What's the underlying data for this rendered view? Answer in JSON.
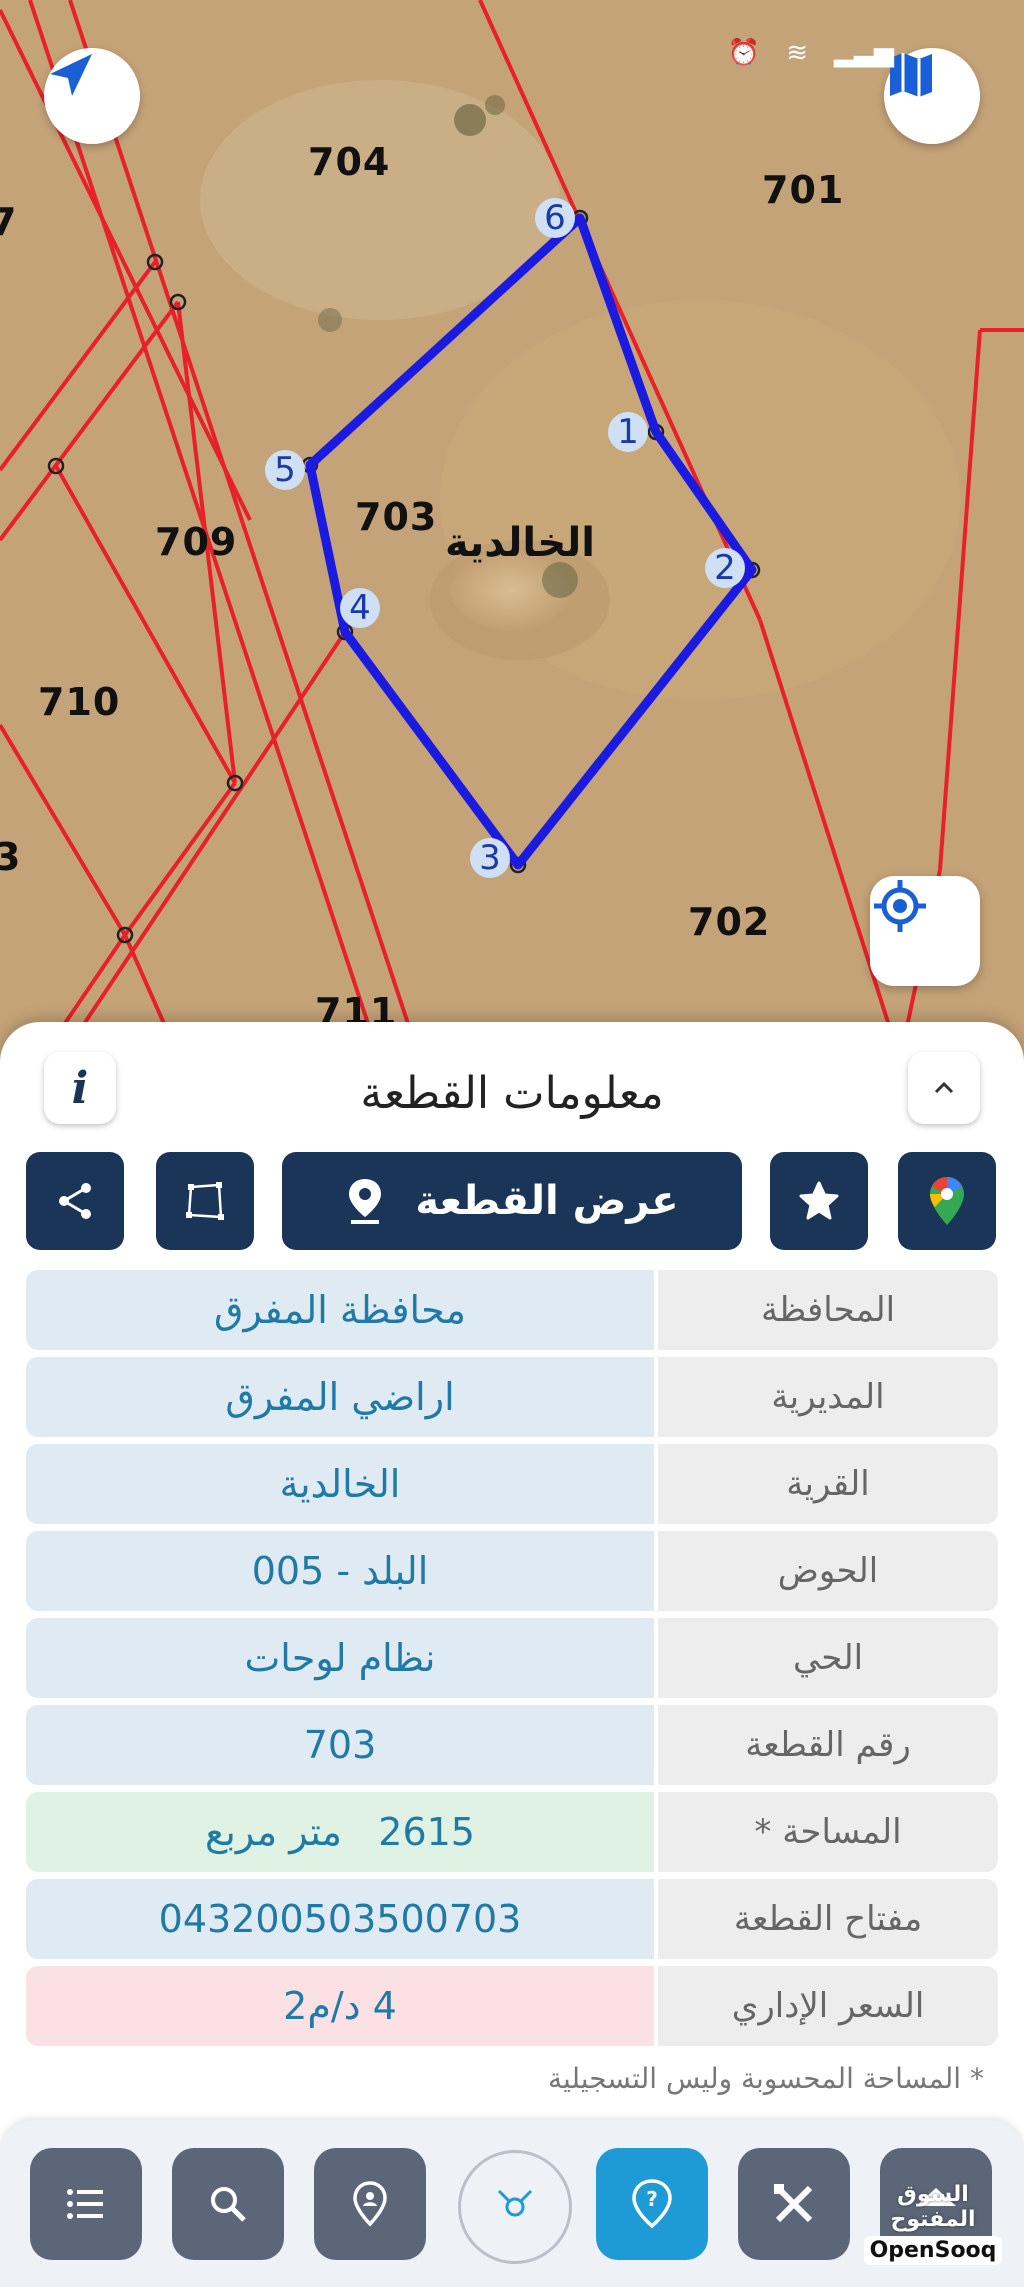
{
  "status_bar": {
    "time": ""
  },
  "map": {
    "parcels": [
      "704",
      "701",
      "709",
      "703",
      "710",
      "702",
      "711",
      "3",
      "7"
    ],
    "village_label": "الخالدية",
    "corners": [
      "6",
      "1",
      "5",
      "2",
      "4",
      "3"
    ]
  },
  "sheet": {
    "title": "معلومات القطعة",
    "info_symbol": "i",
    "show_parcel_label": "عرض القطعة",
    "rows": [
      {
        "label": "المحافظة",
        "value": "محافظة المفرق"
      },
      {
        "label": "المديرية",
        "value": "اراضي المفرق"
      },
      {
        "label": "القرية",
        "value": "الخالدية"
      },
      {
        "label": "الحوض",
        "value": "البلد - 005"
      },
      {
        "label": "الحي",
        "value": "نظام لوحات"
      },
      {
        "label": "رقم القطعة",
        "value": "703"
      },
      {
        "label": "المساحة *",
        "value": "2615   متر مربع"
      },
      {
        "label": "مفتاح القطعة",
        "value": "043200503500703"
      },
      {
        "label": "السعر الإداري",
        "value": "4 د/م2"
      }
    ],
    "footnote": "* المساحة المحسوبة وليس التسجيلية"
  },
  "watermark": {
    "arabic": "السوق المفتوح",
    "english": "OpenSooq"
  },
  "colors": {
    "navy": "#1b3558",
    "accent": "#1e9ad6",
    "parcel_line": "#e8202a",
    "boundary": "#1a1ae0"
  }
}
